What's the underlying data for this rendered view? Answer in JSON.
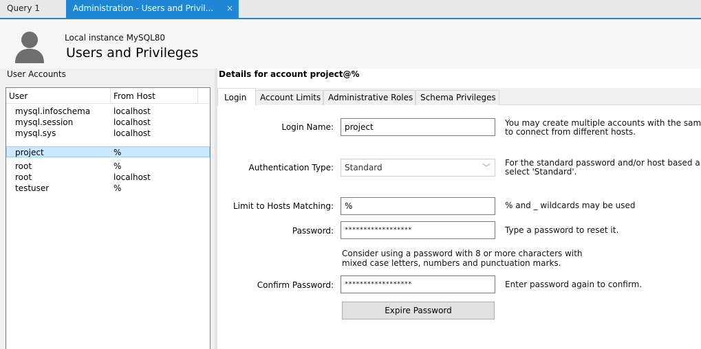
{
  "tabs": [
    {
      "label": "Query 1"
    },
    {
      "label": "Administration - Users and Privil...",
      "close": "×"
    }
  ],
  "header": {
    "instance": "Local instance MySQL80",
    "title": "Users and Privileges"
  },
  "left": {
    "section_label": "User Accounts",
    "columns": [
      "User",
      "From Host"
    ],
    "rows": [
      {
        "user": "mysql.infoschema",
        "host": "localhost"
      },
      {
        "user": "mysql.session",
        "host": "localhost"
      },
      {
        "user": "mysql.sys",
        "host": "localhost"
      },
      {
        "user": "project",
        "host": "%"
      },
      {
        "user": "root",
        "host": "%"
      },
      {
        "user": "root",
        "host": "localhost"
      },
      {
        "user": "testuser",
        "host": "%"
      }
    ],
    "selected_row": 3
  },
  "details": {
    "title": "Details for account project@%",
    "tabs": [
      "Login",
      "Account Limits",
      "Administrative Roles",
      "Schema Privileges"
    ],
    "active_tab": 0,
    "login_name_label": "Login Name:",
    "login_name_value": "project",
    "login_name_hint_1": "You may create multiple accounts with the same",
    "login_name_hint_2": "to connect from different hosts.",
    "auth_label": "Authentication Type:",
    "auth_value": "Standard",
    "auth_hint_1": "For the standard password and/or host based a",
    "auth_hint_2": "select 'Standard'.",
    "hosts_label": "Limit to Hosts Matching:",
    "hosts_value": "%",
    "hosts_hint": "% and _ wildcards may be used",
    "password_label": "Password:",
    "password_value": "******************",
    "password_hint": "Type a password to reset it.",
    "password_note_1": "Consider using a password with 8 or more characters with",
    "password_note_2": "mixed case letters, numbers and punctuation marks.",
    "confirm_label": "Confirm Password:",
    "confirm_value": "******************",
    "confirm_hint": "Enter password again to confirm.",
    "expire_button": "Expire Password"
  }
}
